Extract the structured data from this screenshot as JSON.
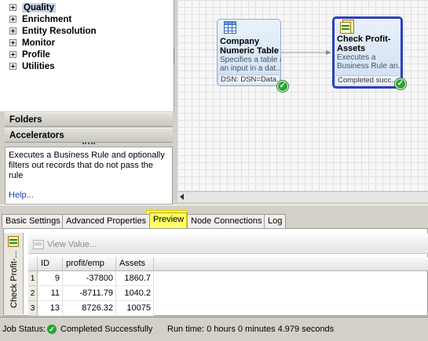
{
  "tree": {
    "items": [
      {
        "label": "Quality",
        "selected": true
      },
      {
        "label": "Enrichment",
        "selected": false
      },
      {
        "label": "Entity Resolution",
        "selected": false
      },
      {
        "label": "Monitor",
        "selected": false
      },
      {
        "label": "Profile",
        "selected": false
      },
      {
        "label": "Utilities",
        "selected": false
      }
    ]
  },
  "sections": {
    "folders": "Folders",
    "accelerators": "Accelerators"
  },
  "description": {
    "text": "Executes a Business Rule and optionally filters out records that do not pass the rule",
    "help_link": "Help..."
  },
  "canvas": {
    "node1": {
      "icon": "table-icon",
      "title": "Company Numeric Table",
      "desc_line1": "Specifies a table as",
      "desc_line2": "an input in a dat...",
      "status": "DSN: DSN=Data...",
      "badge": "✓"
    },
    "node2": {
      "icon": "business-rule-icon",
      "title": "Check Profit-Assets",
      "desc_line1": "Executes a",
      "desc_line2": "Business Rule an...",
      "status": "Completed succ...",
      "badge": "✓"
    }
  },
  "tabs": [
    {
      "label": "Basic Settings",
      "active": false
    },
    {
      "label": "Advanced Properties",
      "active": false
    },
    {
      "label": "Preview",
      "active": true
    },
    {
      "label": "Node Connections",
      "active": false
    },
    {
      "label": "Log",
      "active": false
    }
  ],
  "preview": {
    "node_label": "Check Profit-...",
    "view_value_label": "View Value...",
    "columns": [
      "ID",
      "profit/emp",
      "Assets"
    ],
    "rows": [
      {
        "num": "1",
        "cells": [
          "9",
          "-37800",
          "1860.7"
        ]
      },
      {
        "num": "2",
        "cells": [
          "11",
          "-8711.79",
          "1040.2"
        ]
      },
      {
        "num": "3",
        "cells": [
          "13",
          "8726.32",
          "10075"
        ]
      }
    ]
  },
  "status_bar": {
    "job_status_label": "Job Status:",
    "job_status_value": "Completed Successfully",
    "run_time": "Run time: 0 hours 0 minutes 4.979 seconds"
  },
  "colors": {
    "selected_node_border": "#2f3fb8",
    "preview_highlight": "#ffff66",
    "success_green": "#2aa334"
  }
}
